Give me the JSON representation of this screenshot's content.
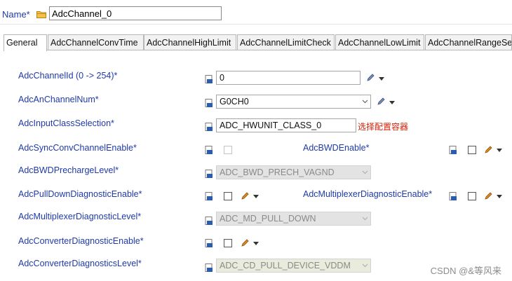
{
  "header": {
    "name_label": "Name*",
    "name_value": "AdcChannel_0"
  },
  "tabs": [
    "General",
    "AdcChannelConvTime",
    "AdcChannelHighLimit",
    "AdcChannelLimitCheck",
    "AdcChannelLowLimit",
    "AdcChannelRangeSe"
  ],
  "active_tab": "General",
  "form": {
    "channel_id": {
      "label": "AdcChannelId (0 -> 254)*",
      "value": "0"
    },
    "an_channel_num": {
      "label": "AdcAnChannelNum*",
      "value": "G0CH0"
    },
    "input_class": {
      "label": "AdcInputClassSelection*",
      "value": "ADC_HWUNIT_CLASS_0",
      "hint": "选择配置容器"
    },
    "sync_conv": {
      "label": "AdcSyncConvChannelEnable*",
      "checked": false,
      "enabled": false
    },
    "bwd_enable": {
      "label": "AdcBWDEnable*",
      "checked": false
    },
    "bwd_precharge": {
      "label": "AdcBWDPrechargeLevel*",
      "value": "ADC_BWD_PRECH_VAGND"
    },
    "pulldown_diag": {
      "label": "AdcPullDownDiagnosticEnable*",
      "checked": false
    },
    "mux_diag_enable": {
      "label": "AdcMultiplexerDiagnosticEnable*",
      "checked": false
    },
    "mux_diag_level": {
      "label": "AdcMultiplexerDiagnosticLevel*",
      "value": "ADC_MD_PULL_DOWN"
    },
    "conv_diag_enable": {
      "label": "AdcConverterDiagnosticEnable*",
      "checked": false
    },
    "conv_diag_level": {
      "label": "AdcConverterDiagnosticsLevel*",
      "value": "ADC_CD_PULL_DEVICE_VDDM"
    }
  },
  "watermark": "CSDN @&等风来",
  "colors": {
    "label_blue": "#1f3aa8",
    "hint_red": "#d81e06",
    "pencil_orange": "#e08a1e"
  }
}
